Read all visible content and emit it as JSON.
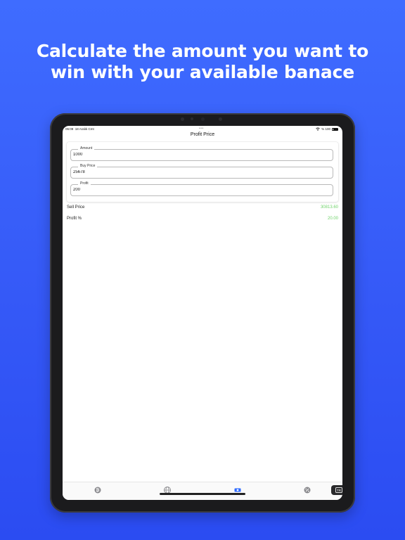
{
  "headline": {
    "line1": "Calculate the amount you want to",
    "line2": "win with your available banace"
  },
  "status_bar": {
    "time": "05:09",
    "date": "18 Aralık Cmt",
    "battery": "% 100"
  },
  "nav": {
    "title": "Profit Price"
  },
  "form": {
    "fields": [
      {
        "label": "Amount",
        "value": "1000"
      },
      {
        "label": "Buy Price",
        "value": "25678"
      },
      {
        "label": "Profit",
        "value": "200"
      }
    ]
  },
  "results": [
    {
      "label": "Sell Price",
      "value": "30813.60"
    },
    {
      "label": "Profit %",
      "value": "20.00"
    }
  ],
  "tabbar": {
    "tabs": [
      {
        "icon": "bitcoin-icon"
      },
      {
        "icon": "globe-icon"
      },
      {
        "icon": "money-icon",
        "active": true
      },
      {
        "icon": "percent-icon"
      }
    ]
  },
  "keyboard_badge": {
    "label": "TR"
  },
  "colors": {
    "background_top": "#3f6cff",
    "background_bottom": "#2b4cf2",
    "positive": "#6fd36a",
    "active_tab": "#2f6bff",
    "inactive_tab": "#8a8a8e"
  }
}
